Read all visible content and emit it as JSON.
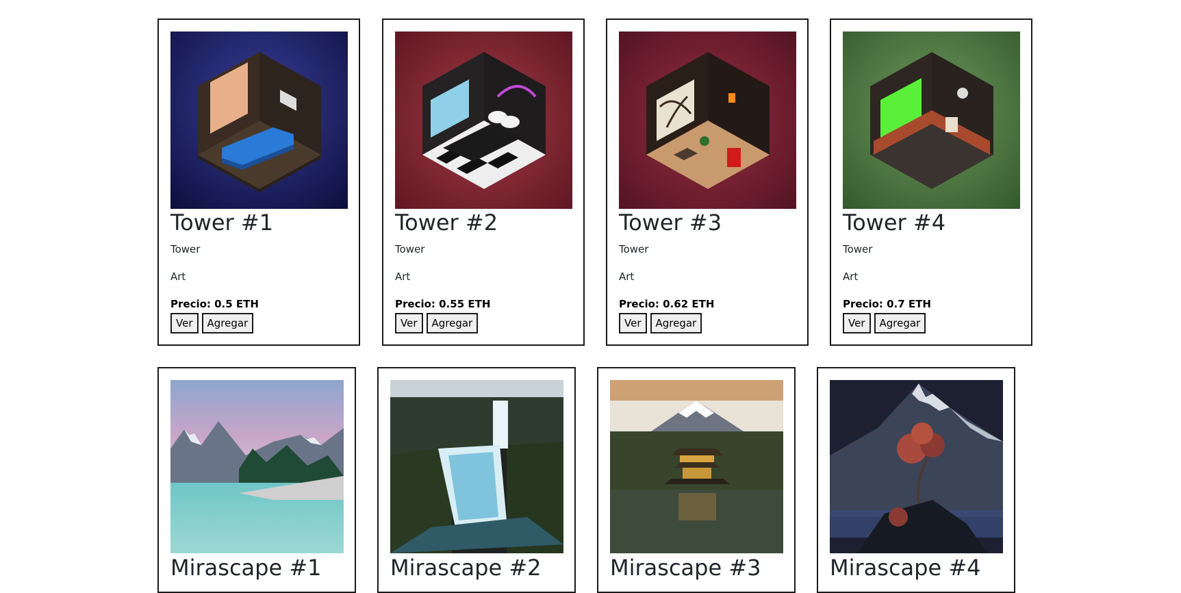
{
  "row1": [
    {
      "title": "Tower #1",
      "collection": "Tower",
      "category": "Art",
      "price": "Precio: 0.5 ETH",
      "view_label": "Ver",
      "add_label": "Agregar",
      "image_theme": "tower-blue-living-room"
    },
    {
      "title": "Tower #2",
      "collection": "Tower",
      "category": "Art",
      "price": "Precio: 0.55 ETH",
      "view_label": "Ver",
      "add_label": "Agregar",
      "image_theme": "tower-red-bedroom"
    },
    {
      "title": "Tower #3",
      "collection": "Tower",
      "category": "Art",
      "price": "Precio: 0.62 ETH",
      "view_label": "Ver",
      "add_label": "Agregar",
      "image_theme": "tower-crimson-study"
    },
    {
      "title": "Tower #4",
      "collection": "Tower",
      "category": "Art",
      "price": "Precio: 0.7 ETH",
      "view_label": "Ver",
      "add_label": "Agregar",
      "image_theme": "tower-green-kitchen"
    }
  ],
  "row2": [
    {
      "title": "Mirascape #1",
      "image_theme": "mountain-lake"
    },
    {
      "title": "Mirascape #2",
      "image_theme": "waterfall"
    },
    {
      "title": "Mirascape #3",
      "image_theme": "pagoda-mount-fuji"
    },
    {
      "title": "Mirascape #4",
      "image_theme": "night-mountain-tree"
    }
  ],
  "colors": {
    "card_border": "#1a1a1a",
    "tower1_bg": "#1e2266",
    "tower2_bg": "#8a2a35",
    "tower3_bg": "#7a2030",
    "tower4_bg": "#4a7040"
  }
}
